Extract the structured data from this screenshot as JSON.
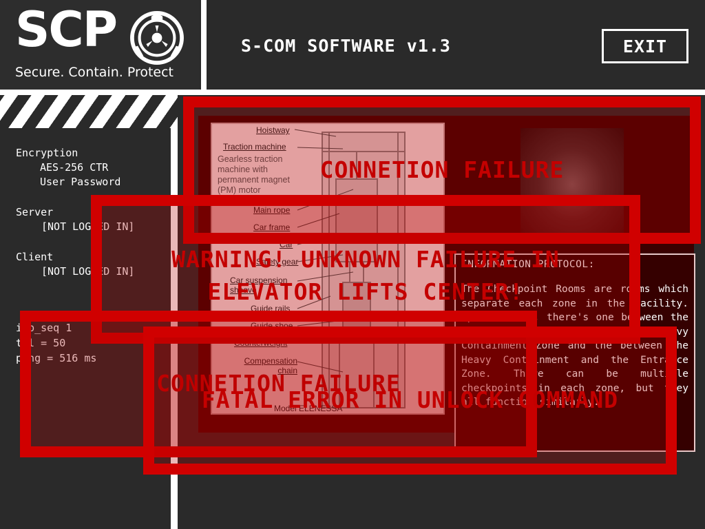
{
  "logo": {
    "name": "SCP",
    "tagline": "Secure. Contain. Protect"
  },
  "header": {
    "title": "S-COM SOFTWARE v1.3",
    "exit_label": "EXIT"
  },
  "left_panel": {
    "encryption_label": "Encryption",
    "encryption_algo": "AES-256 CTR",
    "encryption_auth": "User Password",
    "server_label": "Server",
    "server_status": "[NOT LOGGED IN]",
    "client_label": "Client",
    "client_status": "[NOT LOGGED IN]",
    "imp_seq": "imp_seq 1",
    "ttl": "ttl = 50",
    "ping": "ping = 516 ms"
  },
  "diagram": {
    "labels": [
      "Hoistway",
      "Traction machine",
      "Main rope",
      "Car frame",
      "Car",
      "Safety gear",
      "Car suspension sheave",
      "Guide rails",
      "Guide shoe",
      "Counterweight",
      "Compensation chain",
      "Model ELENESSA"
    ],
    "gearless_note": "Gearless traction machine with permanent magnet (PM) motor"
  },
  "protocol": {
    "title": "INFORMATION PROTOCOL:",
    "body": "The Checkpoint Rooms are rooms which separate each zone in the facility. Specifically, there's one between the Light Containment Zone and the Heavy Containment Zone and the between the Heavy Containment and the Entrance Zone. There can be multiple checkpoints in each zone, but they all function similarly."
  },
  "errors": {
    "e1": "CONNETION FAILURE",
    "e2_line1": "WARNING! UNKNOWN FAILURE IN",
    "e2_line2": "ELEVATOR LIFTS CENTER!",
    "e3": "CONNETION FAILURE",
    "e4": "FATAL ERROR IN UNLOCK COMMAND"
  },
  "colors": {
    "error_red": "#d00000",
    "background": "#2a2a2a",
    "screen_dark_red": "#3b0000"
  }
}
